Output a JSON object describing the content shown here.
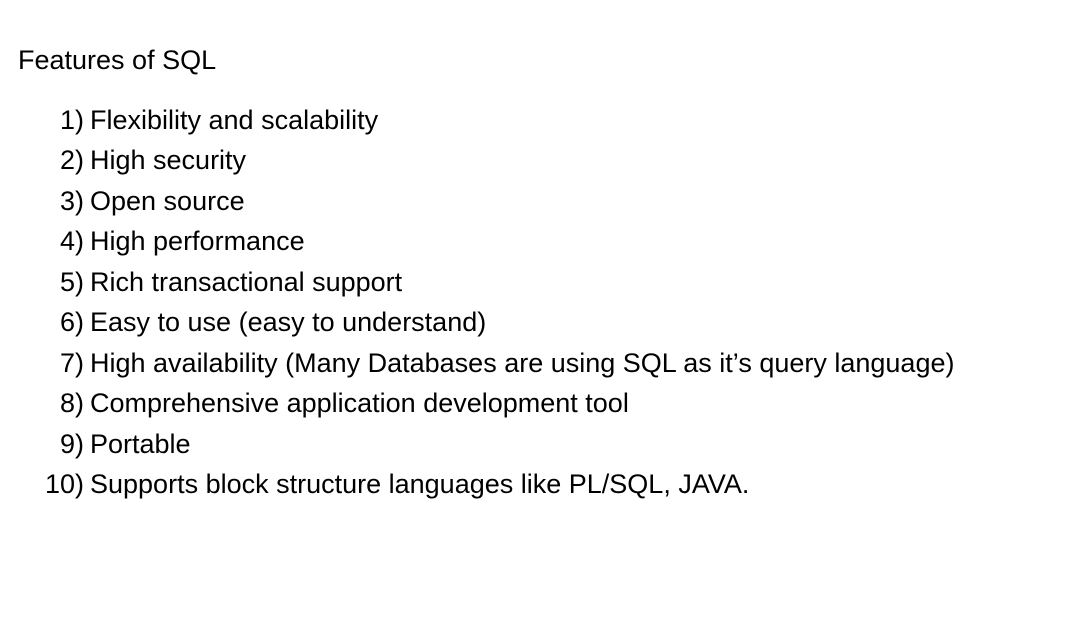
{
  "document": {
    "title": "Features of SQL",
    "items": [
      {
        "number": "1)",
        "text": "Flexibility and scalability"
      },
      {
        "number": "2)",
        "text": "High security"
      },
      {
        "number": "3)",
        "text": "Open source"
      },
      {
        "number": "4)",
        "text": "High performance"
      },
      {
        "number": "5)",
        "text": "Rich transactional support"
      },
      {
        "number": "6)",
        "text": "Easy to use (easy to understand)"
      },
      {
        "number": "7)",
        "text": "High availability (Many Databases are using SQL as it’s query language)"
      },
      {
        "number": "8)",
        "text": "Comprehensive application development tool"
      },
      {
        "number": "9)",
        "text": "Portable"
      },
      {
        "number": "10)",
        "text": "Supports block structure languages like PL/SQL, JAVA."
      }
    ]
  },
  "colors": {
    "background": "#ffffff",
    "text": "#000000"
  }
}
